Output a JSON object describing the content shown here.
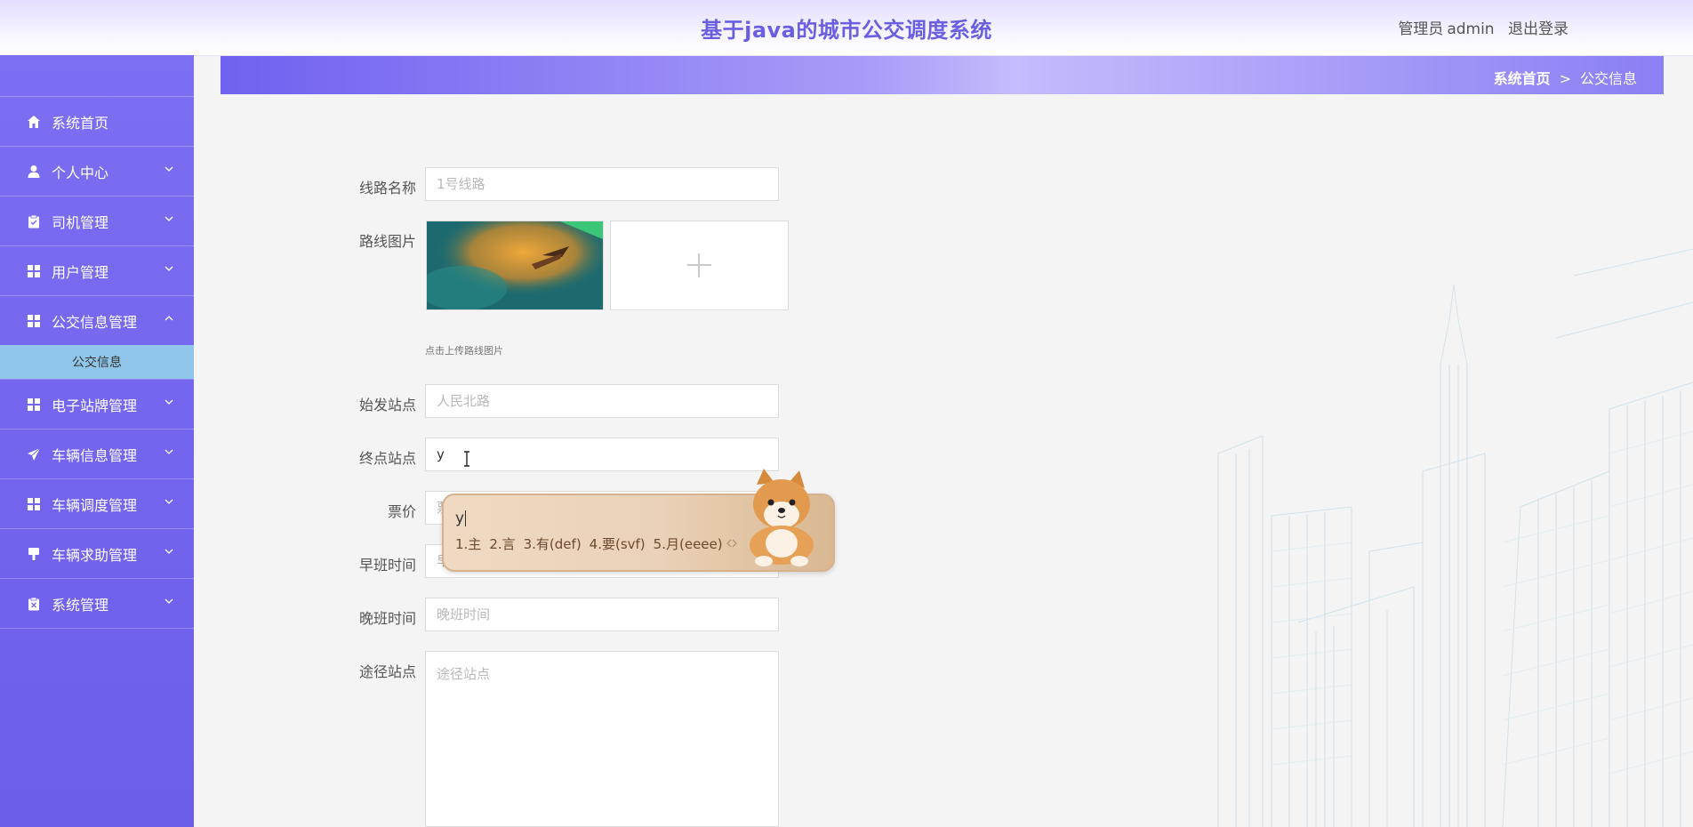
{
  "header": {
    "title": "基于java的城市公交调度系统",
    "role": "管理员",
    "username": "admin",
    "logout": "退出登录"
  },
  "sidebar": {
    "items": [
      {
        "label": "系统首页",
        "icon": "home-icon",
        "expandable": false
      },
      {
        "label": "个人中心",
        "icon": "user-icon",
        "expandable": true,
        "expanded": false
      },
      {
        "label": "司机管理",
        "icon": "clipboard-icon",
        "expandable": true,
        "expanded": false
      },
      {
        "label": "用户管理",
        "icon": "grid-icon",
        "expandable": true,
        "expanded": false
      },
      {
        "label": "公交信息管理",
        "icon": "grid-icon",
        "expandable": true,
        "expanded": true,
        "children": [
          "公交信息"
        ]
      },
      {
        "label": "电子站牌管理",
        "icon": "grid-icon",
        "expandable": true,
        "expanded": false
      },
      {
        "label": "车辆信息管理",
        "icon": "send-icon",
        "expandable": true,
        "expanded": false
      },
      {
        "label": "车辆调度管理",
        "icon": "grid-icon",
        "expandable": true,
        "expanded": false
      },
      {
        "label": "车辆求助管理",
        "icon": "stamp-icon",
        "expandable": true,
        "expanded": false
      },
      {
        "label": "系统管理",
        "icon": "clipboard-x-icon",
        "expandable": true,
        "expanded": false
      }
    ]
  },
  "breadcrumb": {
    "home": "系统首页",
    "separator": ">",
    "current": "公交信息"
  },
  "form": {
    "route_name": {
      "label": "线路名称",
      "placeholder": "1号线路",
      "value": ""
    },
    "route_image": {
      "label": "路线图片",
      "hint": "点击上传路线图片"
    },
    "start_station": {
      "label": "始发站点",
      "placeholder": "人民北路",
      "value": ""
    },
    "end_station": {
      "label": "终点站点",
      "placeholder": "",
      "value": "y"
    },
    "fare": {
      "label": "票价",
      "placeholder": "票价",
      "value": ""
    },
    "morning_shift": {
      "label": "早班时间",
      "placeholder": "早班时间",
      "value": ""
    },
    "evening_shift": {
      "label": "晚班时间",
      "placeholder": "晚班时间",
      "value": ""
    },
    "via_stations": {
      "label": "途径站点",
      "placeholder": "途径站点",
      "value": ""
    }
  },
  "ime": {
    "composition": "y",
    "candidates": [
      "1.主",
      "2.言",
      "3.有(def)",
      "4.要(svf)",
      "5.月(eeee)"
    ]
  },
  "colors": {
    "accent": "#6a5fe0",
    "sidebar": "#7468ef",
    "active_submenu": "#8fc6ea"
  }
}
